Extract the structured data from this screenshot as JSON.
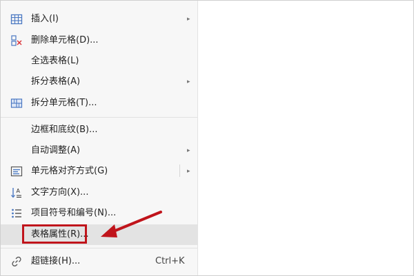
{
  "menu": {
    "items": [
      {
        "label": "插入(I)",
        "icon": "table-insert-icon",
        "submenu": true
      },
      {
        "label": "删除单元格(D)...",
        "icon": "delete-cell-icon",
        "submenu": false
      },
      {
        "label": "全选表格(L)",
        "icon": "",
        "submenu": false
      },
      {
        "label": "拆分表格(A)",
        "icon": "",
        "submenu": true
      },
      {
        "label": "拆分单元格(T)...",
        "icon": "split-cell-icon",
        "submenu": false
      },
      {
        "label": "边框和底纹(B)...",
        "icon": "",
        "submenu": false
      },
      {
        "label": "自动调整(A)",
        "icon": "",
        "submenu": true
      },
      {
        "label": "单元格对齐方式(G)",
        "icon": "cell-alignment-icon",
        "submenu": true
      },
      {
        "label": "文字方向(X)...",
        "icon": "text-direction-icon",
        "submenu": false
      },
      {
        "label": "项目符号和编号(N)...",
        "icon": "bullet-list-icon",
        "submenu": false
      },
      {
        "label": "表格属性(R)...",
        "icon": "",
        "submenu": false,
        "highlighted": true
      },
      {
        "label": "超链接(H)...",
        "icon": "hyperlink-icon",
        "submenu": false,
        "shortcut": "Ctrl+K"
      }
    ]
  },
  "colors": {
    "annotation_red": "#c0141b",
    "icon_blue": "#4a78c2",
    "menu_bg": "#f7f7f7",
    "highlight_bg": "#e3e3e3"
  }
}
